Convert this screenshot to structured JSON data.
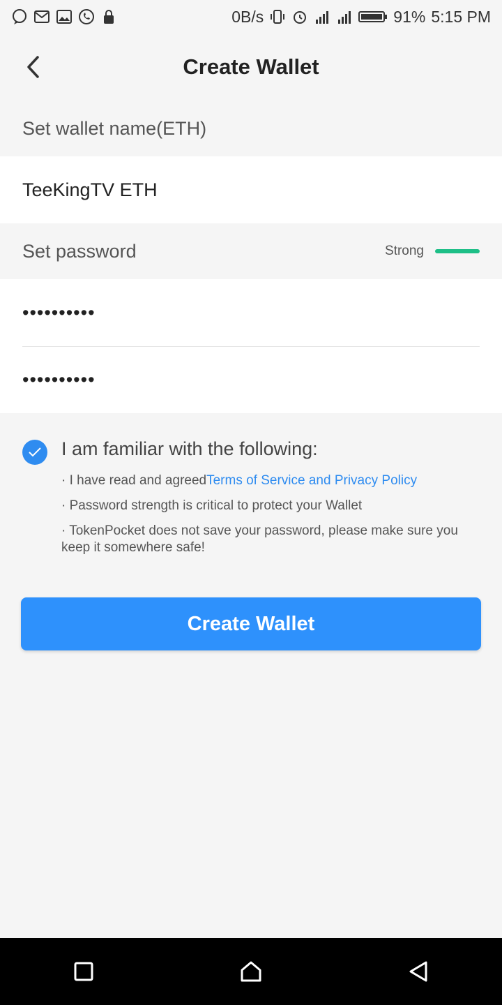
{
  "status_bar": {
    "net_speed": "0B/s",
    "battery": "91%",
    "time": "5:15 PM",
    "left_icons": [
      "chat-bubble-icon",
      "mail-icon",
      "image-icon",
      "whatsapp-icon",
      "lock-icon"
    ],
    "right_icons": [
      "vibrate-icon",
      "alarm-icon",
      "signal-icon",
      "signal-icon",
      "battery-icon"
    ]
  },
  "header": {
    "title": "Create Wallet",
    "back_icon": "chevron-left-icon"
  },
  "wallet_name": {
    "label": "Set wallet name(ETH)",
    "value": "TeeKingTV ETH"
  },
  "password": {
    "label": "Set password",
    "strength_label": "Strong",
    "strength_color": "#1dbf87",
    "value": "••••••••••",
    "confirm_value": "••••••••••"
  },
  "terms": {
    "checked": true,
    "heading": "I am familiar with the following:",
    "line1_prefix": "· I have read and agreed",
    "line1_link": "Terms of Service and Privacy Policy",
    "line2": "· Password strength is critical to protect your Wallet",
    "line3": "· TokenPocket does not save your password, please make sure you keep it somewhere safe!"
  },
  "actions": {
    "create_label": "Create Wallet",
    "accent": "#2e91fc"
  },
  "nav_bar": {
    "icons": [
      "recent-apps-icon",
      "home-icon",
      "back-icon"
    ]
  }
}
